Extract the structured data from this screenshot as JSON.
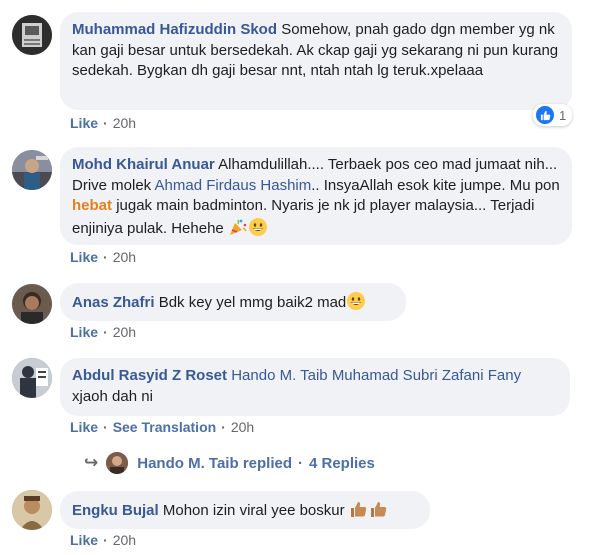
{
  "comments": [
    {
      "author": "Muhammad Hafizuddin Skod",
      "text": "Somehow, pnah gado dgn member yg nk kan gaji besar untuk bersedekah. Ak ckap gaji yg sekarang ni pun kurang sedekah. Bygkan dh gaji besar nnt, ntah ntah lg teruk.xpelaaa",
      "like": "Like",
      "time": "20h",
      "reaction_count": "1"
    },
    {
      "author": "Mohd Khairul Anuar",
      "text_a": "Alhamdulillah.... Terbaek pos ceo mad jumaat nih... Drive molek",
      "mention": "Ahmad Firdaus Hashim",
      "text_b": ".. InsyaAllah esok kite jumpe. Mu pon",
      "highlight": "hebat",
      "text_c": "jugak main badminton. Nyaris je nk jd player malaysia... Terjadi enjiniya pulak. Hehehe",
      "like": "Like",
      "time": "20h"
    },
    {
      "author": "Anas Zhafri",
      "text": "Bdk key yel mmg baik2 mad",
      "like": "Like",
      "time": "20h"
    },
    {
      "author": "Abdul Rasyid Z Roset",
      "mention": "Hando M. Taib Muhamad Subri Zafani Fany",
      "text": "xjaoh dah ni",
      "like": "Like",
      "translation": "See Translation",
      "time": "20h",
      "replies": {
        "name": "Hando M. Taib",
        "replied": "replied",
        "count": "4 Replies"
      }
    },
    {
      "author": "Engku Bujal",
      "text": "Mohon izin viral yee boskur",
      "like": "Like",
      "time": "20h"
    }
  ],
  "icons": {
    "like_badge": "thumbs-up-icon",
    "reply_arrow": "reply-arrow-icon",
    "grin": "grinning-face-emoji",
    "party": "party-popper-emoji",
    "thumbs": "thumbs-up-emoji"
  },
  "colors": {
    "link": "#385898",
    "bubble": "#f0f2f5",
    "accent": "#1877f2",
    "highlight": "#e4811f"
  }
}
